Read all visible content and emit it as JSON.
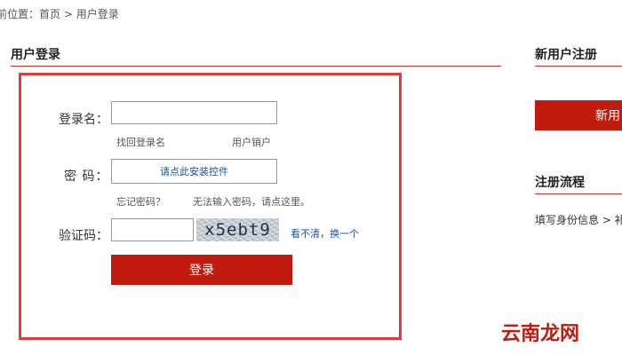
{
  "breadcrumb": {
    "prefix": "前位置：",
    "home": "首页",
    "separator": ">",
    "current": "用户登录"
  },
  "login_panel": {
    "title": "用户登录",
    "username_label": "登录名：",
    "username_value": "",
    "find_username_link": "找回登录名",
    "cancel_account_link": "用户销户",
    "password_label": "密 码：",
    "password_control_text": "请点此安装控件",
    "forgot_password_link": "忘记密码？",
    "cannot_input_link": "无法输入密码，请点这里。",
    "captcha_label": "验证码：",
    "captcha_value": "",
    "captcha_text": "x5ebt9",
    "refresh_captcha_link": "看不清，换一个",
    "login_button": "登录"
  },
  "register_panel": {
    "title": "新用户注册",
    "button_label": "新用"
  },
  "process_panel": {
    "title": "注册流程",
    "steps_text": "填写身份信息 > 补"
  },
  "watermark": "云南龙网",
  "colors": {
    "accent_red": "#c11a0f",
    "box_border": "#e03c3c",
    "link_blue": "#1a4fa0"
  }
}
